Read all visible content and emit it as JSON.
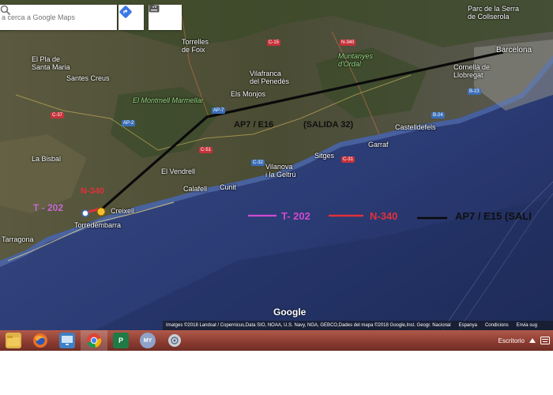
{
  "search": {
    "placeholder": "a cerca a Google Maps"
  },
  "toolbar": {
    "directions_icon": "directions-icon",
    "keyboard_icon": "keyboard-icon"
  },
  "labels": {
    "barcelona": "Barcelona",
    "tarragona": "Tarragona",
    "torredembarra": "Torredembarra",
    "sitges": "Sitges",
    "vilanova": "Vilanova\ni la Geltrú",
    "vilafranca": "Vilafranca\ndel Penedès",
    "montmell": "El Montmell Marmellar",
    "muntanyes": "Muntanyes\nd'Ordal",
    "castelldefels": "Castelldefels",
    "garraf": "Garraf",
    "vendrell": "El Vendrell",
    "calafell": "Calafell",
    "cunit": "Cunit",
    "creixell": "Creixell",
    "elsmonjos": "Els Monjos",
    "torrellesfoix": "Torrelles\nde Foix",
    "santcreus": "Santes Creus",
    "lapobla": "El Pla de\nSanta Maria",
    "cornella": "Cornellà de\nLlobregat",
    "serra": "Parc de la Serra\nde Collserola",
    "labisbal": "La Bisbal"
  },
  "roads": {
    "c15": "C-15",
    "n340a": "N-340",
    "ap7a": "AP-7",
    "c32": "C-32",
    "c31": "C-31",
    "b24": "B-24",
    "c51": "C-51",
    "ap2": "AP-2",
    "c37": "C-37",
    "b23": "B-23"
  },
  "annotations": {
    "ap7_main": "AP7 / E16",
    "salida": "(SALIDA 32)",
    "n340_map": "N-340",
    "t202_map": "T - 202",
    "legend_t202": "T- 202",
    "legend_n340": "N-340",
    "legend_ap7": "AP7 / E15 (SALI"
  },
  "colors": {
    "sea": "#2a3b6e",
    "land": "#4a4a34",
    "route_black": "#0a0a0a",
    "t202": "#d04ad0",
    "n340": "#e0313a"
  },
  "google_logo": "Google",
  "attribution": {
    "imagery": "Imatges ©2018 Landsat / Copernicus,Data SIO, NOAA, U.S. Navy, NGA, GEBCO,Dades del mapa ©2018 Google,Inst. Geogr. Nacional",
    "country": "Espanya",
    "terms": "Condicions",
    "feedback": "Envia sug"
  },
  "taskbar": {
    "items": [
      {
        "name": "file-explorer-icon",
        "color": "#e0b44a",
        "glyph": ""
      },
      {
        "name": "firefox-icon",
        "color": "#e8702a",
        "glyph": ""
      },
      {
        "name": "remote-desktop-icon",
        "color": "#3f7fc4",
        "glyph": ""
      },
      {
        "name": "chrome-icon",
        "color": "#ffffff",
        "glyph": ""
      },
      {
        "name": "publisher-icon",
        "color": "#1f7a45",
        "glyph": "P"
      },
      {
        "name": "my-app-icon",
        "color": "#8fa3c9",
        "glyph": "MY"
      },
      {
        "name": "network-app-icon",
        "color": "#c9cfd8",
        "glyph": ""
      }
    ],
    "tray_label": "Escritorio"
  }
}
